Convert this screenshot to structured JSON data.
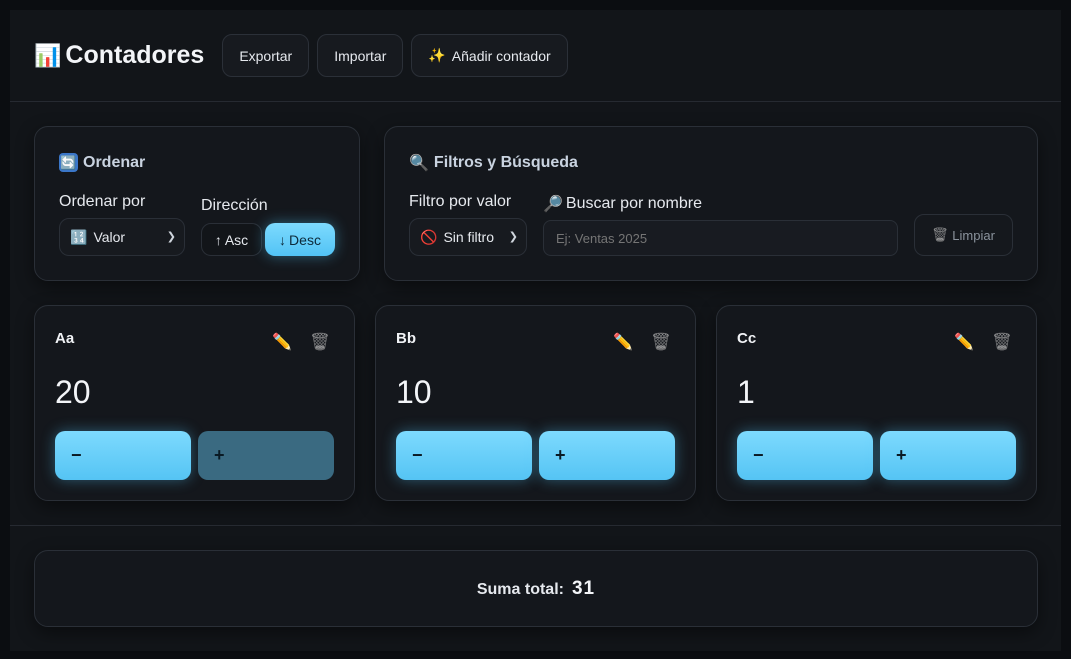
{
  "header": {
    "title_icon": "bar-chart-icon",
    "title": "Contadores",
    "export_label": "Exportar",
    "import_label": "Importar",
    "add_label": "Añadir contador",
    "add_icon": "sparkles-icon"
  },
  "sort": {
    "title": "Ordenar",
    "title_icon": "arrows-cycle-icon",
    "order_by_label": "Ordenar por",
    "order_by_value": "Valor",
    "order_by_icon": "numbers-icon",
    "direction_label": "Dirección",
    "asc_label": "Asc",
    "desc_label": "Desc",
    "active_direction": "desc"
  },
  "filters": {
    "title": "Filtros y Búsqueda",
    "title_icon": "magnifier-icon",
    "value_filter_label": "Filtro por valor",
    "value_filter_value": "Sin filtro",
    "value_filter_icon": "no-entry-icon",
    "search_label": "Buscar por nombre",
    "search_icon": "magnifier-right-icon",
    "search_placeholder": "Ej: Ventas 2025",
    "search_value": "",
    "clear_label": "Limpiar",
    "clear_icon": "trash-icon"
  },
  "counters": [
    {
      "name": "Aa",
      "value": "20",
      "minus": "−",
      "plus": "+"
    },
    {
      "name": "Bb",
      "value": "10",
      "minus": "−",
      "plus": "+"
    },
    {
      "name": "Cc",
      "value": "1",
      "minus": "−",
      "plus": "+"
    }
  ],
  "total": {
    "label": "Suma total:",
    "value": "31"
  },
  "colors": {
    "accent": "#5cc8f6",
    "background": "#121519",
    "panel": "#14171c"
  }
}
